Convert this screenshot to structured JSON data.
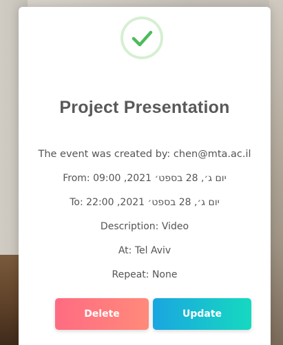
{
  "event": {
    "title": "Project Presentation",
    "creator_text": "The event was created by: chen@mta.ac.il",
    "from_label": "From:",
    "from_value": "יום ג׳, 28 בספט׳ 2021, 09:00",
    "to_label": "To:",
    "to_value": "יום ג׳, 28 בספט׳ 2021, 22:00",
    "description_text": "Description: Video",
    "location_text": "At: Tel Aviv",
    "repeat_text": "Repeat: None"
  },
  "actions": {
    "delete_label": "Delete",
    "update_label": "Update"
  },
  "icons": {
    "success": "check-icon"
  },
  "colors": {
    "success_green": "#4cbb5c",
    "success_ring": "#d6efd2",
    "delete_start": "#ff6b82",
    "delete_end": "#ff8a7a",
    "update_start": "#1aa6e0",
    "update_end": "#16d9c0",
    "text": "#545454"
  }
}
